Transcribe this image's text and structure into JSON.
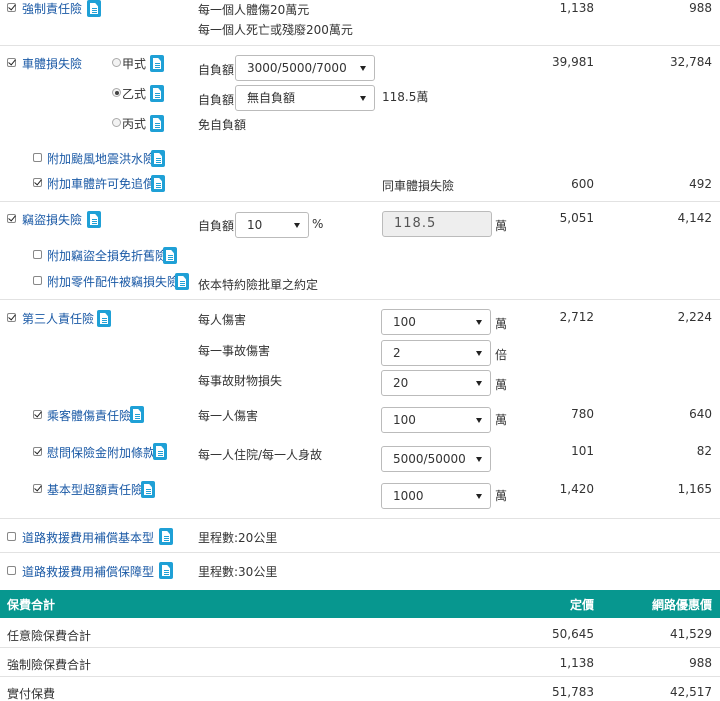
{
  "compulsory": {
    "label": "強制責任險",
    "desc1": "每一個人體傷20萬元",
    "desc2": "每一個人死亡或殘廢200萬元",
    "price": "1,138",
    "discount": "988"
  },
  "vehicle_damage": {
    "label": "車體損失險",
    "price": "39,981",
    "discount": "32,784",
    "types": [
      {
        "label": "甲式",
        "deductible_label": "自負額",
        "deductible_value": "3000/5000/7000"
      },
      {
        "label": "乙式",
        "deductible_label": "自負額",
        "deductible_value": "無自負額",
        "amount": "118.5萬"
      },
      {
        "label": "丙式",
        "deductible_label": "免自負額"
      }
    ],
    "typhoon": {
      "label": "附加颱風地震洪水險"
    },
    "subrogation": {
      "label": "附加車體許可免追償",
      "note": "同車體損失險",
      "price": "600",
      "discount": "492"
    }
  },
  "theft": {
    "label": "竊盜損失險",
    "deductible_label": "自負額",
    "deductible_value": "10",
    "percent": "%",
    "amount_value": "118.5",
    "amount_unit": "萬",
    "price": "5,051",
    "discount": "4,142",
    "addon1": {
      "label": "附加竊盜全損免折舊險"
    },
    "addon2": {
      "label": "附加零件配件被竊損失險",
      "note": "依本特約險批單之約定"
    }
  },
  "third_party": {
    "label": "第三人責任險",
    "price": "2,712",
    "discount": "2,224",
    "rows": [
      {
        "label": "每人傷害",
        "value": "100",
        "unit": "萬"
      },
      {
        "label": "每一事故傷害",
        "value": "2",
        "unit": "倍"
      },
      {
        "label": "每事故財物損失",
        "value": "20",
        "unit": "萬"
      }
    ],
    "passenger": {
      "label": "乘客體傷責任險",
      "field_label": "每一人傷害",
      "value": "100",
      "unit": "萬",
      "price": "780",
      "discount": "640"
    },
    "consolation": {
      "label": "慰問保險金附加條款",
      "field_label": "每一人住院/每一人身故",
      "value": "5000/50000",
      "price": "101",
      "discount": "82"
    },
    "excess": {
      "label": "基本型超額責任險",
      "value": "1000",
      "unit": "萬",
      "price": "1,420",
      "discount": "1,165"
    }
  },
  "roadside_basic": {
    "label": "道路救援費用補償基本型",
    "note": "里程數:20公里"
  },
  "roadside_plus": {
    "label": "道路救援費用補償保障型",
    "note": "里程數:30公里"
  },
  "summary": {
    "header": "保費合計",
    "col_price": "定價",
    "col_discount": "網路優惠價",
    "rows": [
      {
        "label": "任意險保費合計",
        "price": "50,645",
        "discount": "41,529"
      },
      {
        "label": "強制險保費合計",
        "price": "1,138",
        "discount": "988"
      },
      {
        "label": "實付保費",
        "price": "51,783",
        "discount": "42,517"
      }
    ]
  }
}
